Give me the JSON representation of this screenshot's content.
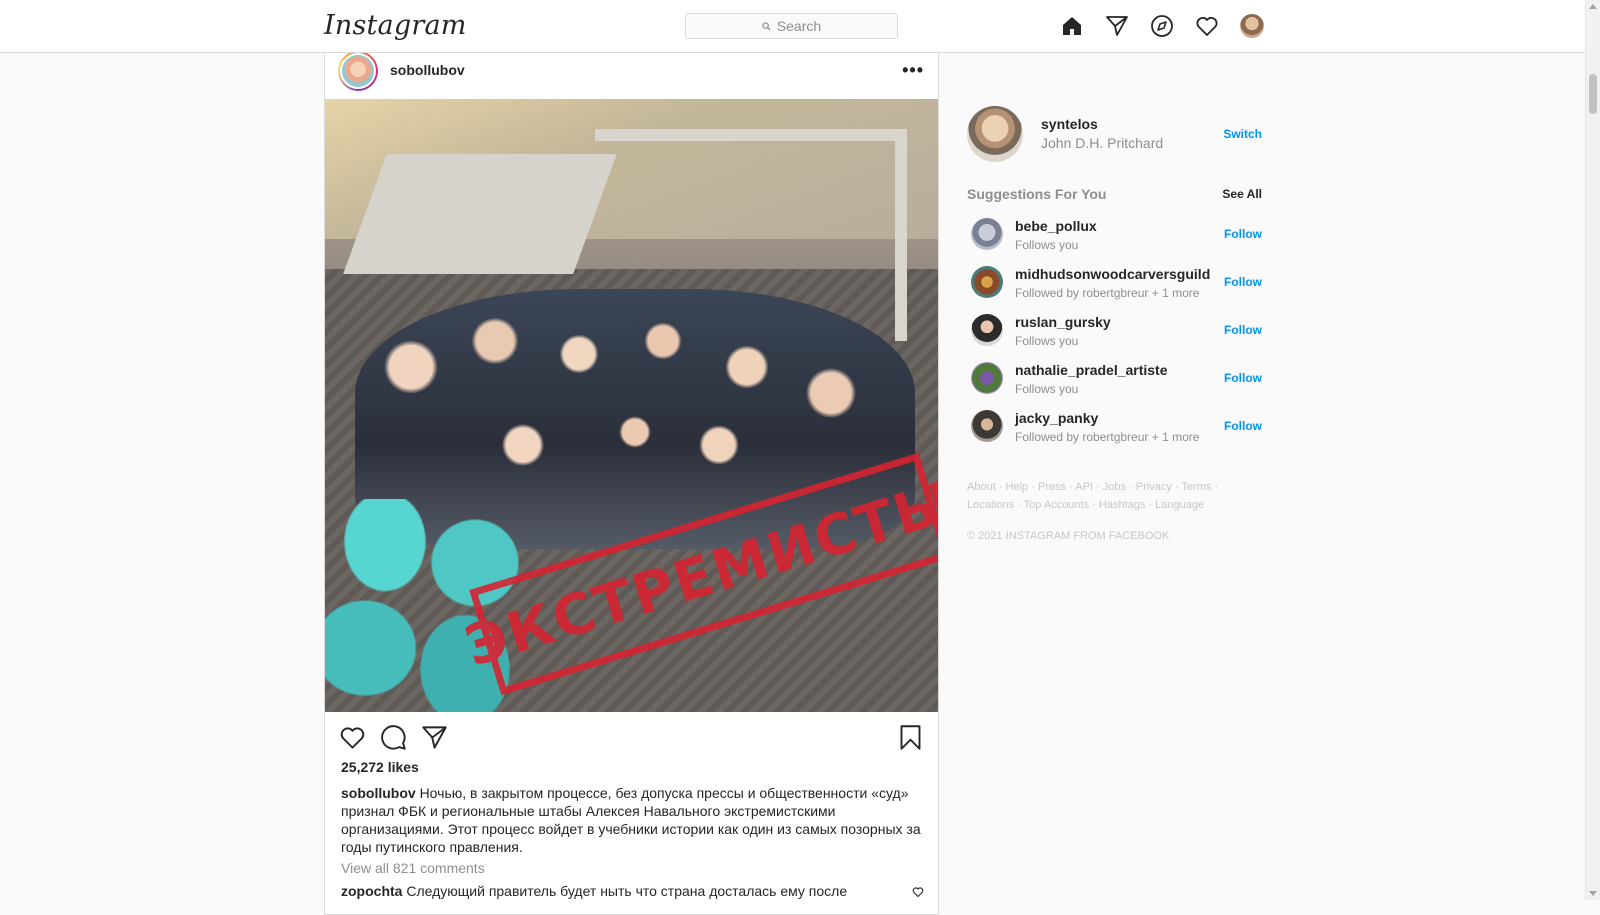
{
  "nav": {
    "logo": "Instagram",
    "search_placeholder": "Search",
    "icons": [
      "home-icon",
      "direct-icon",
      "explore-icon",
      "activity-heart-icon",
      "profile-avatar"
    ]
  },
  "post": {
    "username": "sobollubov",
    "more_label": "•••",
    "stamp_text": "ЭКСТРЕМИСТЫ",
    "likes": "25,272 likes",
    "caption_user": "sobollubov",
    "caption_text": "Ночью, в закрытом процессе, без допуска прессы и общественности «суд» признал ФБК и региональные штабы Алексея Навального экстремистскими организациями. Этот процесс войдет в учебники истории как один из самых позорных за годы путинского правления.",
    "view_all_comments": "View all 821 comments",
    "comment_user": "zopochta",
    "comment_text": "Следующий правитель будет ныть что страна досталась ему после"
  },
  "me": {
    "username": "syntelos",
    "full_name": "John D.H. Pritchard",
    "switch_label": "Switch"
  },
  "suggestions": {
    "title": "Suggestions For You",
    "see_all": "See All",
    "items": [
      {
        "username": "bebe_pollux",
        "sub": "Follows you",
        "action": "Follow"
      },
      {
        "username": "midhudsonwoodcarversguild",
        "sub": "Followed by robertgbreur + 1 more",
        "action": "Follow"
      },
      {
        "username": "ruslan_gursky",
        "sub": "Follows you",
        "action": "Follow"
      },
      {
        "username": "nathalie_pradel_artiste",
        "sub": "Follows you",
        "action": "Follow"
      },
      {
        "username": "jacky_panky",
        "sub": "Followed by robertgbreur + 1 more",
        "action": "Follow"
      }
    ]
  },
  "footer": {
    "links": [
      "About",
      "Help",
      "Press",
      "API",
      "Jobs",
      "Privacy",
      "Terms",
      "Locations",
      "Top Accounts",
      "Hashtags",
      "Language"
    ],
    "copyright": "© 2021 INSTAGRAM FROM FACEBOOK"
  },
  "colors": {
    "accent": "#0095f6",
    "muted": "#8e8e8e",
    "stamp_red": "#d62331",
    "border": "#dbdbdb"
  }
}
